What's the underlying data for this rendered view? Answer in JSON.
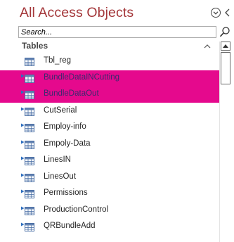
{
  "navigation_pane": {
    "title": "All Access Objects",
    "menu_icon": "chevron-down-circle-icon",
    "shutter_icon": "chevron-left-icon",
    "search": {
      "value": "",
      "placeholder": "Search...",
      "icon": "search-icon"
    },
    "group": {
      "label": "Tables",
      "collapse_icon": "chevron-up-icon"
    },
    "items": [
      {
        "label": "Tbl_reg",
        "linked": false,
        "highlighted": false
      },
      {
        "label": "BundleDataINCutting",
        "linked": true,
        "highlighted": true
      },
      {
        "label": "BundleDataOut",
        "linked": true,
        "highlighted": true
      },
      {
        "label": "CutSerial",
        "linked": true,
        "highlighted": false
      },
      {
        "label": "Employ-info",
        "linked": true,
        "highlighted": false
      },
      {
        "label": "Empoly-Data",
        "linked": true,
        "highlighted": false
      },
      {
        "label": "LinesIN",
        "linked": true,
        "highlighted": false
      },
      {
        "label": "LinesOut",
        "linked": true,
        "highlighted": false
      },
      {
        "label": "Permissions",
        "linked": true,
        "highlighted": false
      },
      {
        "label": "ProductionControl",
        "linked": true,
        "highlighted": false
      },
      {
        "label": "QRBundleAdd",
        "linked": true,
        "highlighted": false
      }
    ]
  },
  "colors": {
    "title": "#a4373a",
    "highlight": "#e5098d",
    "link_arrow": "#2e6fbf",
    "table_icon_border": "#4a6fa5"
  }
}
